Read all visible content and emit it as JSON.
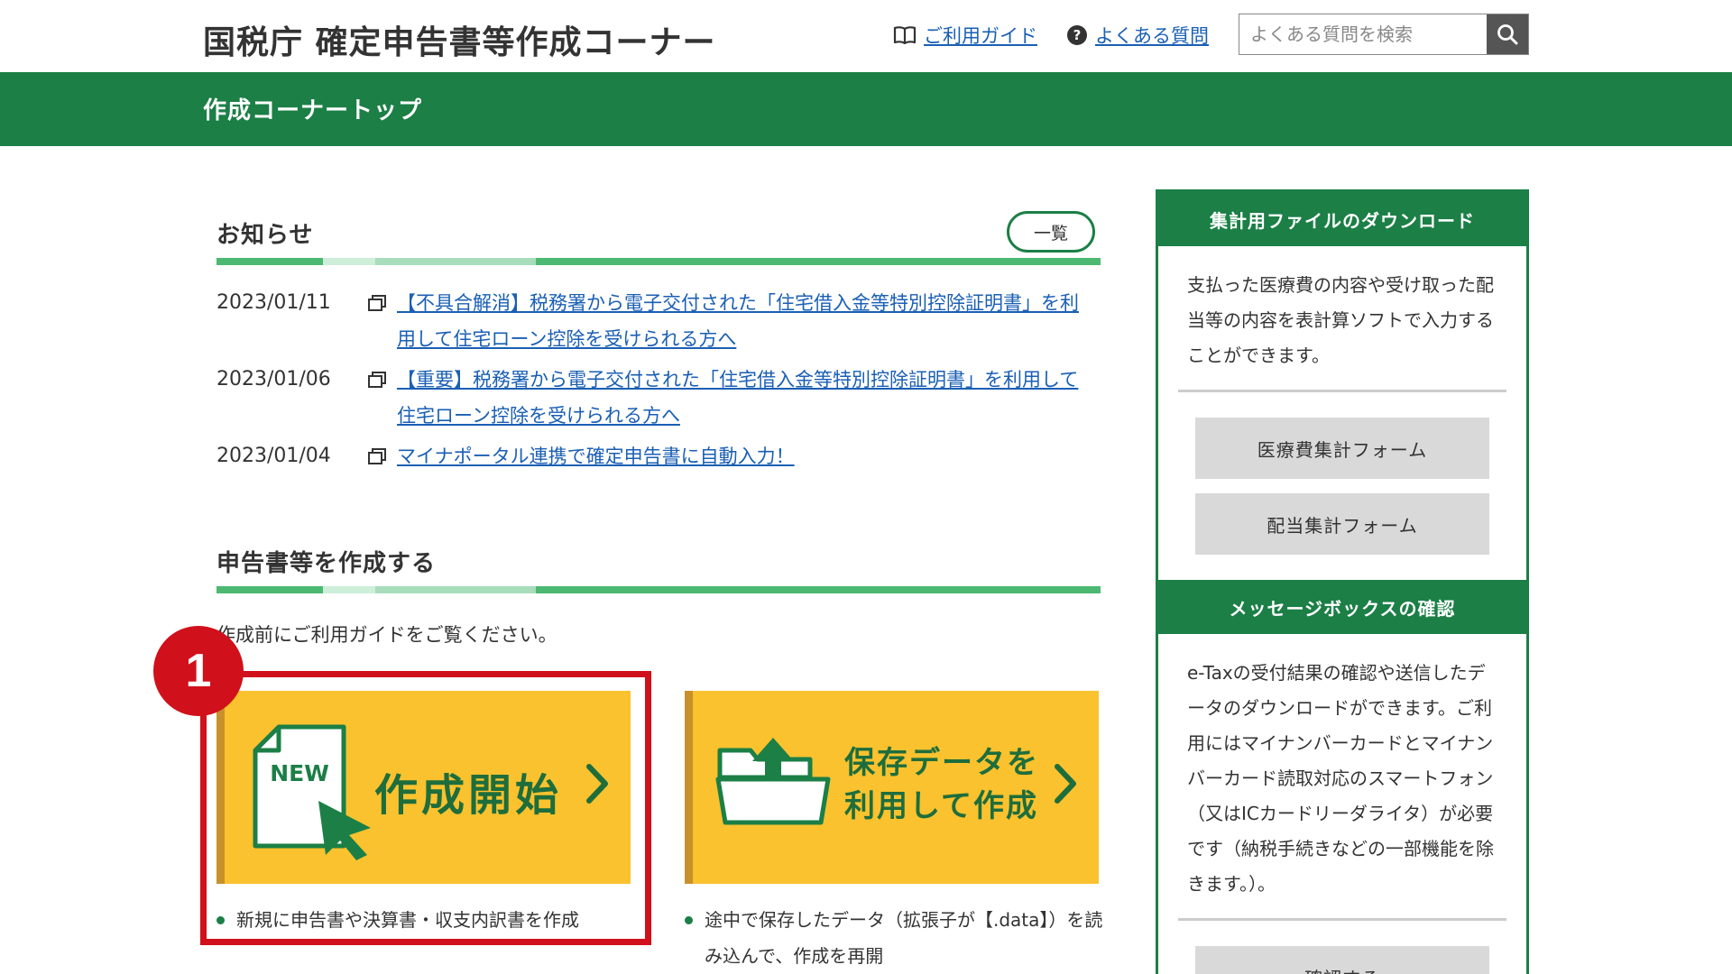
{
  "header": {
    "site_title": "国税庁 確定申告書等作成コーナー",
    "guide_link": "ご利用ガイド",
    "faq_link": "よくある質問",
    "search_placeholder": "よくある質問を検索"
  },
  "page_heading": "作成コーナートップ",
  "notices": {
    "title": "お知らせ",
    "list_button": "一覧",
    "items": [
      {
        "date": "2023/01/11",
        "text": "【不具合解消】税務署から電子交付された「住宅借入金等特別控除証明書」を利用して住宅ローン控除を受けられる方へ"
      },
      {
        "date": "2023/01/06",
        "text": "【重要】税務署から電子交付された「住宅借入金等特別控除証明書」を利用して住宅ローン控除を受けられる方へ"
      },
      {
        "date": "2023/01/04",
        "text": "マイナポータル連携で確定申告書に自動入力！"
      }
    ]
  },
  "create": {
    "title": "申告書等を作成する",
    "intro": "作成前にご利用ガイドをご覧ください。",
    "start": {
      "icon_text": "NEW",
      "label": "作成開始",
      "note": "新規に申告書や決算書・収支内訳書を作成"
    },
    "saved": {
      "label_line1": "保存データを",
      "label_line2": "利用して作成",
      "note": "途中で保存したデータ（拡張子が【.data】）を読み込んで、作成を再開"
    }
  },
  "annotation": {
    "step_number": "1"
  },
  "sidebar": {
    "download": {
      "title": "集計用ファイルのダウンロード",
      "text": "支払った医療費の内容や受け取った配当等の内容を表計算ソフトで入力することができます。",
      "buttons": [
        "医療費集計フォーム",
        "配当集計フォーム"
      ]
    },
    "messagebox": {
      "title": "メッセージボックスの確認",
      "text": "e-Taxの受付結果の確認や送信したデータのダウンロードができます。ご利用にはマイナンバーカードとマイナンバーカード読取対応のスマートフォン（又はICカードリーダライタ）が必要です（納税手続きなどの一部機能を除きます。）。",
      "button": "確認する"
    }
  },
  "colors": {
    "brand_green": "#1b7f46",
    "card_yellow": "#f9c22e",
    "highlight_red": "#d0101a",
    "link_blue": "#1a5fb4"
  }
}
